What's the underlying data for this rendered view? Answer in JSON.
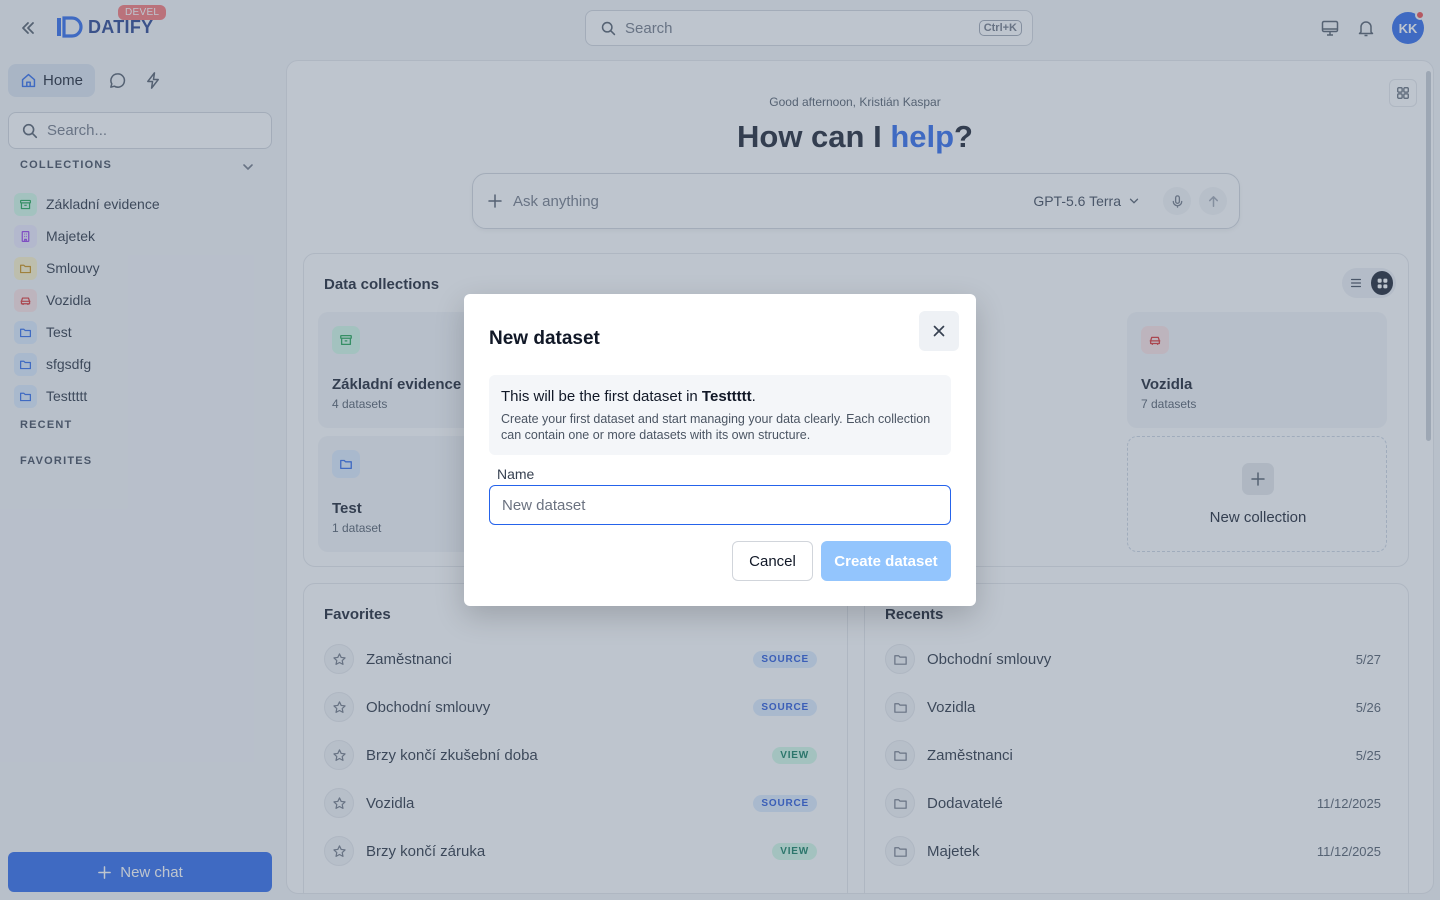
{
  "app": {
    "name": "DATIFY",
    "env_badge": "DEVEL"
  },
  "top_search": {
    "placeholder": "Search",
    "shortcut": "Ctrl+K"
  },
  "user": {
    "initials": "KK"
  },
  "sidebar": {
    "home_label": "Home",
    "search_placeholder": "Search...",
    "collections_heading": "COLLECTIONS",
    "collections": [
      {
        "label": "Základní evidence",
        "icon": "archive-icon",
        "color": "#16a34a",
        "bg": "#d1fae5"
      },
      {
        "label": "Majetek",
        "icon": "building-icon",
        "color": "#9333ea",
        "bg": "#ede9fe"
      },
      {
        "label": "Smlouvy",
        "icon": "folder-icon",
        "color": "#ca8a04",
        "bg": "#fef3c7"
      },
      {
        "label": "Vozidla",
        "icon": "car-icon",
        "color": "#dc2626",
        "bg": "#fee2e2"
      },
      {
        "label": "Test",
        "icon": "folder-icon",
        "color": "#2563eb",
        "bg": "#dbeafe"
      },
      {
        "label": "sfgsdfg",
        "icon": "folder-icon",
        "color": "#2563eb",
        "bg": "#dbeafe"
      },
      {
        "label": "Testtttt",
        "icon": "folder-icon",
        "color": "#2563eb",
        "bg": "#dbeafe"
      }
    ],
    "recent_heading": "RECENT",
    "favorites_heading": "FAVORITES",
    "new_chat_label": "New chat"
  },
  "main": {
    "greeting": "Good afternoon, Kristián Kaspar",
    "hero_prefix": "How can I ",
    "hero_highlight": "help",
    "hero_suffix": "?",
    "ask_placeholder": "Ask anything",
    "model": "GPT-5.6 Terra",
    "collections_title": "Data collections",
    "cards": [
      {
        "title": "Základní evidence",
        "subtitle": "4 datasets",
        "icon": "archive-icon",
        "color": "#16a34a",
        "bg": "#d1fae5"
      },
      {
        "title": "Vozidla",
        "subtitle": "7 datasets",
        "icon": "car-icon",
        "color": "#dc2626",
        "bg": "#fee2e2"
      },
      {
        "title": "Test",
        "subtitle": "1 dataset",
        "icon": "folder-icon",
        "color": "#2563eb",
        "bg": "#dbeafe"
      }
    ],
    "new_collection_label": "New collection",
    "favorites_title": "Favorites",
    "favorites": [
      {
        "label": "Zaměstnanci",
        "badge": "SOURCE",
        "type": "source"
      },
      {
        "label": "Obchodní smlouvy",
        "badge": "SOURCE",
        "type": "source"
      },
      {
        "label": "Brzy končí zkušební doba",
        "badge": "VIEW",
        "type": "view"
      },
      {
        "label": "Vozidla",
        "badge": "SOURCE",
        "type": "source"
      },
      {
        "label": "Brzy končí záruka",
        "badge": "VIEW",
        "type": "view"
      }
    ],
    "recents_title": "Recents",
    "recents": [
      {
        "label": "Obchodní smlouvy",
        "date": "5/27"
      },
      {
        "label": "Vozidla",
        "date": "5/26"
      },
      {
        "label": "Zaměstnanci",
        "date": "5/25"
      },
      {
        "label": "Dodavatelé",
        "date": "11/12/2025"
      },
      {
        "label": "Majetek",
        "date": "11/12/2025"
      }
    ]
  },
  "modal": {
    "title": "New dataset",
    "info_prefix": "This will be the first dataset in ",
    "info_collection": "Testtttt",
    "info_suffix": ".",
    "info_body": "Create your first dataset and start managing your data clearly. Each collection can contain one or more datasets with its own structure.",
    "name_label": "Name",
    "name_value": "",
    "name_placeholder": "New dataset",
    "cancel_label": "Cancel",
    "create_label": "Create dataset"
  }
}
